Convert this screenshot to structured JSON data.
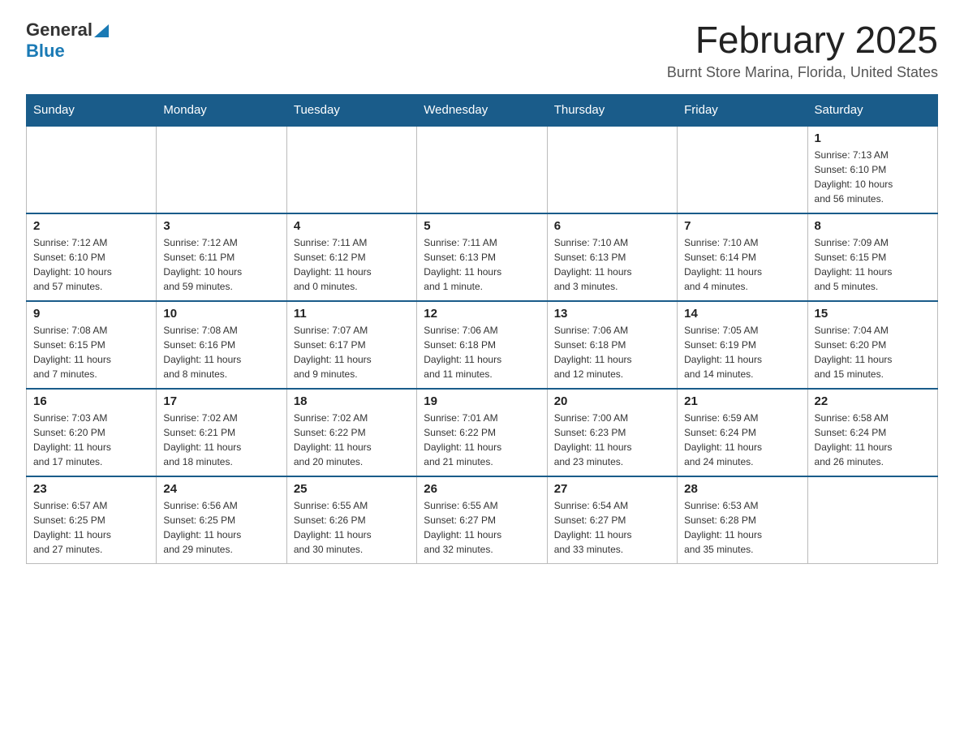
{
  "logo": {
    "general": "General",
    "blue": "Blue"
  },
  "header": {
    "month_title": "February 2025",
    "location": "Burnt Store Marina, Florida, United States"
  },
  "days_of_week": [
    "Sunday",
    "Monday",
    "Tuesday",
    "Wednesday",
    "Thursday",
    "Friday",
    "Saturday"
  ],
  "weeks": [
    {
      "days": [
        {
          "number": "",
          "info": "",
          "empty": true
        },
        {
          "number": "",
          "info": "",
          "empty": true
        },
        {
          "number": "",
          "info": "",
          "empty": true
        },
        {
          "number": "",
          "info": "",
          "empty": true
        },
        {
          "number": "",
          "info": "",
          "empty": true
        },
        {
          "number": "",
          "info": "",
          "empty": true
        },
        {
          "number": "1",
          "info": "Sunrise: 7:13 AM\nSunset: 6:10 PM\nDaylight: 10 hours\nand 56 minutes.",
          "empty": false
        }
      ]
    },
    {
      "days": [
        {
          "number": "2",
          "info": "Sunrise: 7:12 AM\nSunset: 6:10 PM\nDaylight: 10 hours\nand 57 minutes.",
          "empty": false
        },
        {
          "number": "3",
          "info": "Sunrise: 7:12 AM\nSunset: 6:11 PM\nDaylight: 10 hours\nand 59 minutes.",
          "empty": false
        },
        {
          "number": "4",
          "info": "Sunrise: 7:11 AM\nSunset: 6:12 PM\nDaylight: 11 hours\nand 0 minutes.",
          "empty": false
        },
        {
          "number": "5",
          "info": "Sunrise: 7:11 AM\nSunset: 6:13 PM\nDaylight: 11 hours\nand 1 minute.",
          "empty": false
        },
        {
          "number": "6",
          "info": "Sunrise: 7:10 AM\nSunset: 6:13 PM\nDaylight: 11 hours\nand 3 minutes.",
          "empty": false
        },
        {
          "number": "7",
          "info": "Sunrise: 7:10 AM\nSunset: 6:14 PM\nDaylight: 11 hours\nand 4 minutes.",
          "empty": false
        },
        {
          "number": "8",
          "info": "Sunrise: 7:09 AM\nSunset: 6:15 PM\nDaylight: 11 hours\nand 5 minutes.",
          "empty": false
        }
      ]
    },
    {
      "days": [
        {
          "number": "9",
          "info": "Sunrise: 7:08 AM\nSunset: 6:15 PM\nDaylight: 11 hours\nand 7 minutes.",
          "empty": false
        },
        {
          "number": "10",
          "info": "Sunrise: 7:08 AM\nSunset: 6:16 PM\nDaylight: 11 hours\nand 8 minutes.",
          "empty": false
        },
        {
          "number": "11",
          "info": "Sunrise: 7:07 AM\nSunset: 6:17 PM\nDaylight: 11 hours\nand 9 minutes.",
          "empty": false
        },
        {
          "number": "12",
          "info": "Sunrise: 7:06 AM\nSunset: 6:18 PM\nDaylight: 11 hours\nand 11 minutes.",
          "empty": false
        },
        {
          "number": "13",
          "info": "Sunrise: 7:06 AM\nSunset: 6:18 PM\nDaylight: 11 hours\nand 12 minutes.",
          "empty": false
        },
        {
          "number": "14",
          "info": "Sunrise: 7:05 AM\nSunset: 6:19 PM\nDaylight: 11 hours\nand 14 minutes.",
          "empty": false
        },
        {
          "number": "15",
          "info": "Sunrise: 7:04 AM\nSunset: 6:20 PM\nDaylight: 11 hours\nand 15 minutes.",
          "empty": false
        }
      ]
    },
    {
      "days": [
        {
          "number": "16",
          "info": "Sunrise: 7:03 AM\nSunset: 6:20 PM\nDaylight: 11 hours\nand 17 minutes.",
          "empty": false
        },
        {
          "number": "17",
          "info": "Sunrise: 7:02 AM\nSunset: 6:21 PM\nDaylight: 11 hours\nand 18 minutes.",
          "empty": false
        },
        {
          "number": "18",
          "info": "Sunrise: 7:02 AM\nSunset: 6:22 PM\nDaylight: 11 hours\nand 20 minutes.",
          "empty": false
        },
        {
          "number": "19",
          "info": "Sunrise: 7:01 AM\nSunset: 6:22 PM\nDaylight: 11 hours\nand 21 minutes.",
          "empty": false
        },
        {
          "number": "20",
          "info": "Sunrise: 7:00 AM\nSunset: 6:23 PM\nDaylight: 11 hours\nand 23 minutes.",
          "empty": false
        },
        {
          "number": "21",
          "info": "Sunrise: 6:59 AM\nSunset: 6:24 PM\nDaylight: 11 hours\nand 24 minutes.",
          "empty": false
        },
        {
          "number": "22",
          "info": "Sunrise: 6:58 AM\nSunset: 6:24 PM\nDaylight: 11 hours\nand 26 minutes.",
          "empty": false
        }
      ]
    },
    {
      "days": [
        {
          "number": "23",
          "info": "Sunrise: 6:57 AM\nSunset: 6:25 PM\nDaylight: 11 hours\nand 27 minutes.",
          "empty": false
        },
        {
          "number": "24",
          "info": "Sunrise: 6:56 AM\nSunset: 6:25 PM\nDaylight: 11 hours\nand 29 minutes.",
          "empty": false
        },
        {
          "number": "25",
          "info": "Sunrise: 6:55 AM\nSunset: 6:26 PM\nDaylight: 11 hours\nand 30 minutes.",
          "empty": false
        },
        {
          "number": "26",
          "info": "Sunrise: 6:55 AM\nSunset: 6:27 PM\nDaylight: 11 hours\nand 32 minutes.",
          "empty": false
        },
        {
          "number": "27",
          "info": "Sunrise: 6:54 AM\nSunset: 6:27 PM\nDaylight: 11 hours\nand 33 minutes.",
          "empty": false
        },
        {
          "number": "28",
          "info": "Sunrise: 6:53 AM\nSunset: 6:28 PM\nDaylight: 11 hours\nand 35 minutes.",
          "empty": false
        },
        {
          "number": "",
          "info": "",
          "empty": true
        }
      ]
    }
  ]
}
